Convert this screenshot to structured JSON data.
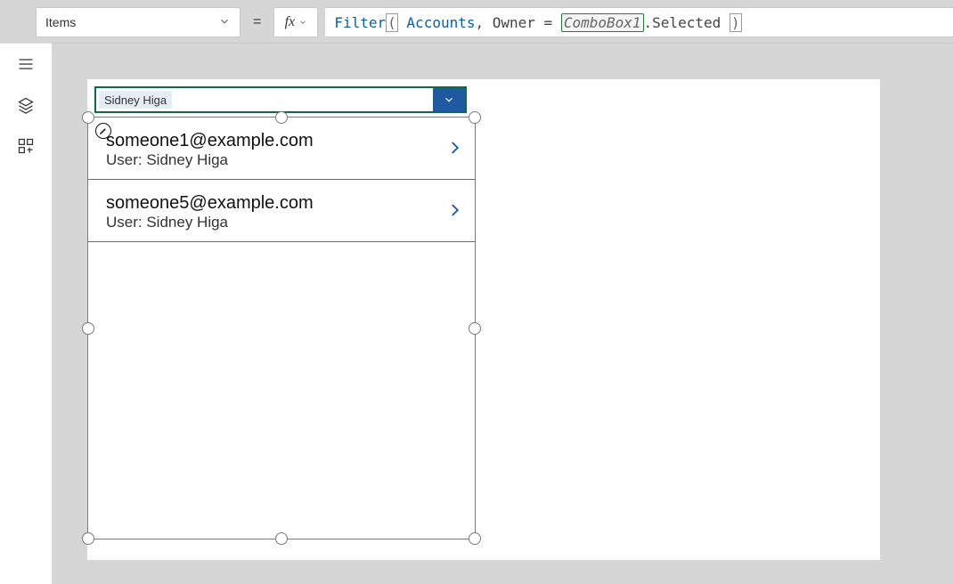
{
  "property_select": {
    "label": "Items"
  },
  "formula": {
    "func": "Filter",
    "lparen": "(",
    "arg1": "Accounts",
    "comma_sp": ", ",
    "owner": "Owner",
    "eq": " = ",
    "combo_ref": "ComboBox1",
    "dot_sel": ".Selected ",
    "rparen": ")"
  },
  "combo": {
    "selected": "Sidney Higa"
  },
  "gallery": {
    "items": [
      {
        "email": "someone1@example.com",
        "user_line": "User: Sidney Higa"
      },
      {
        "email": "someone5@example.com",
        "user_line": "User: Sidney Higa"
      }
    ]
  }
}
